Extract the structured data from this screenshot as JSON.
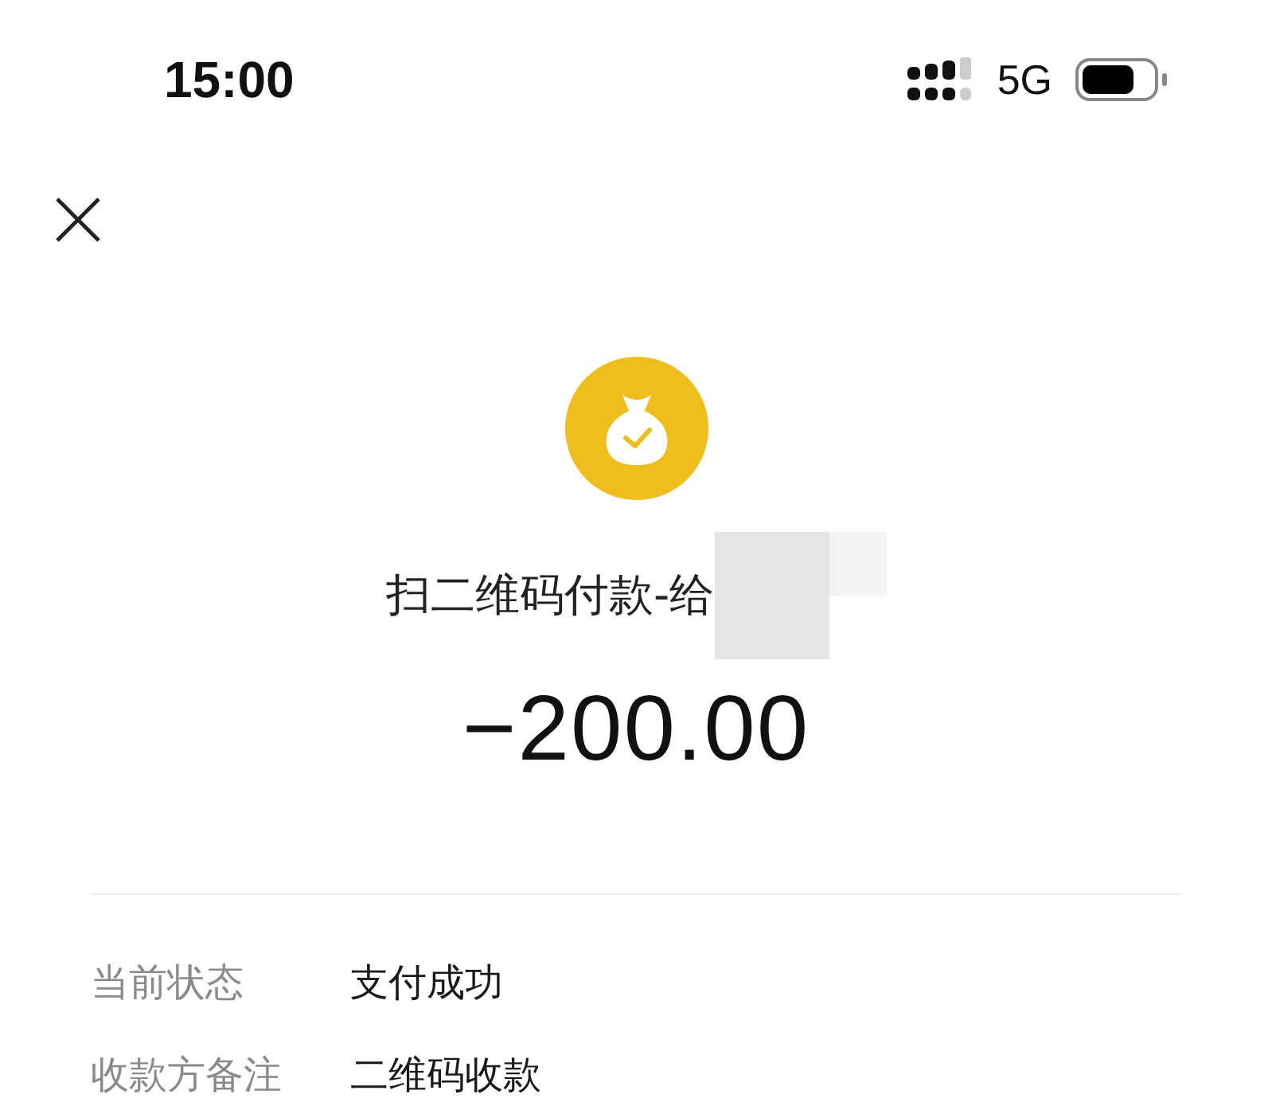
{
  "status_bar": {
    "time": "15:00",
    "network": "5G"
  },
  "title": "扫二维码付款-给",
  "amount": "−200.00",
  "details": [
    {
      "label": "当前状态",
      "value": "支付成功"
    },
    {
      "label": "收款方备注",
      "value": "二维码收款"
    }
  ]
}
